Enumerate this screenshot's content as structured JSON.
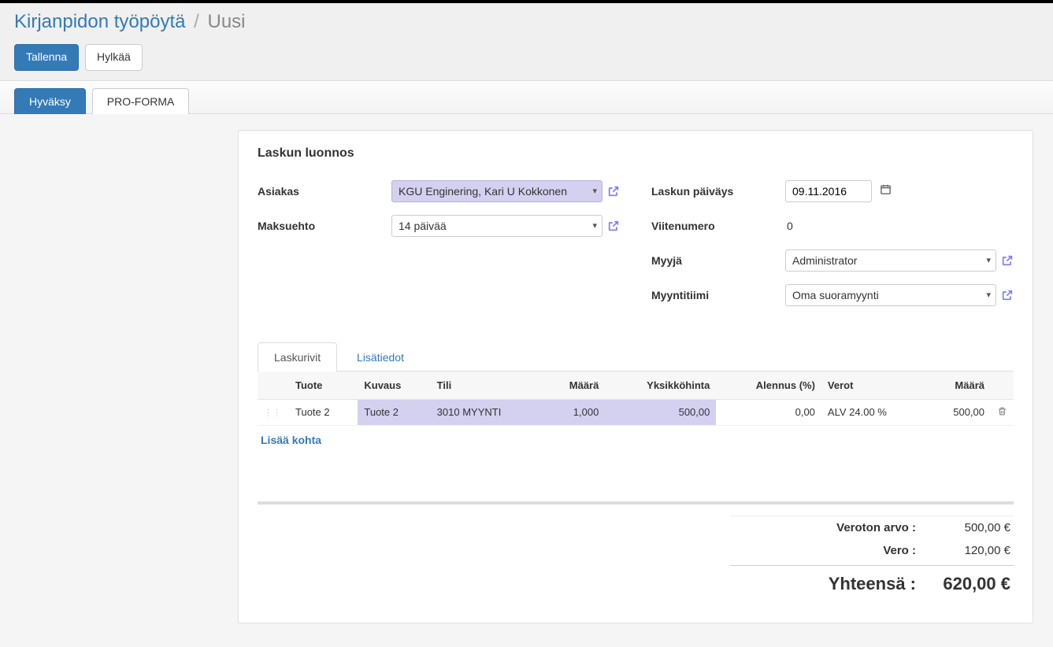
{
  "breadcrumb": {
    "root": "Kirjanpidon työpöytä",
    "current": "Uusi"
  },
  "buttons": {
    "save": "Tallenna",
    "discard": "Hylkää",
    "approve": "Hyväksy",
    "proforma": "PRO-FORMA"
  },
  "form": {
    "title": "Laskun luonnos",
    "customer_label": "Asiakas",
    "customer_value": "KGU Enginering, Kari U Kokkonen",
    "payment_term_label": "Maksuehto",
    "payment_term_value": "14 päivää",
    "invoice_date_label": "Laskun päiväys",
    "invoice_date_value": "09.11.2016",
    "reference_label": "Viitenumero",
    "reference_value": "0",
    "salesperson_label": "Myyjä",
    "salesperson_value": "Administrator",
    "salesteam_label": "Myyntitiimi",
    "salesteam_value": "Oma suoramyynti"
  },
  "tabs": {
    "lines": "Laskurivit",
    "other": "Lisätiedot"
  },
  "table": {
    "headers": {
      "product": "Tuote",
      "description": "Kuvaus",
      "account": "Tili",
      "qty": "Määrä",
      "unit_price": "Yksikköhinta",
      "discount": "Alennus (%)",
      "taxes": "Verot",
      "amount": "Määrä"
    },
    "rows": [
      {
        "product": "Tuote 2",
        "description": "Tuote 2",
        "account": "3010 MYYNTI",
        "qty": "1,000",
        "unit_price": "500,00",
        "discount": "0,00",
        "taxes": "ALV 24.00 %",
        "amount": "500,00"
      }
    ],
    "add_line": "Lisää kohta"
  },
  "totals": {
    "untaxed_label": "Veroton arvo :",
    "untaxed_value": "500,00 €",
    "tax_label": "Vero :",
    "tax_value": "120,00 €",
    "total_label": "Yhteensä :",
    "total_value": "620,00 €"
  }
}
